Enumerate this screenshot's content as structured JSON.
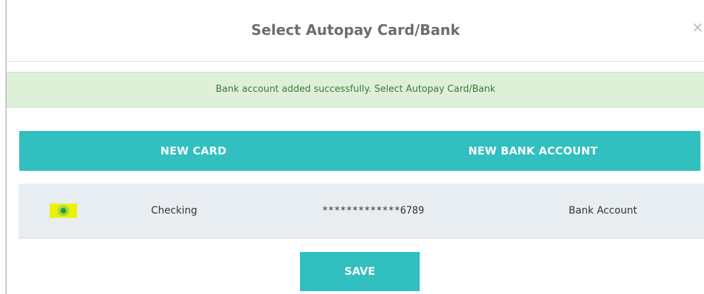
{
  "dialog": {
    "title": "Select Autopay Card/Bank",
    "close_glyph": "×"
  },
  "alert": {
    "message": "Bank account added successfully. Select Autopay Card/Bank"
  },
  "actions": {
    "new_card_label": "NEW CARD",
    "new_bank_label": "NEW BANK ACCOUNT"
  },
  "accounts": [
    {
      "selected": true,
      "type": "Checking",
      "number": "*************6789",
      "kind": "Bank Account"
    }
  ],
  "footer": {
    "save_label": "SAVE"
  },
  "colors": {
    "accent": "#31bfbf",
    "alert_bg": "#dff0d8",
    "alert_text": "#3c763d",
    "radio_highlight": "#eaf200",
    "radio_selected": "#2aa12f"
  }
}
